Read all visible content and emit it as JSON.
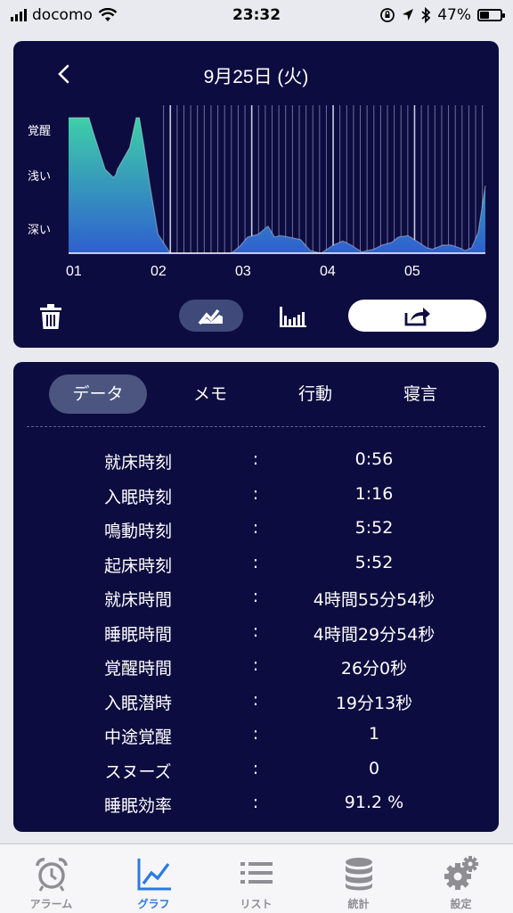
{
  "status_bar": {
    "carrier": "docomo",
    "time": "23:32",
    "battery_percent": "47%",
    "battery_level": 0.47,
    "icons": [
      "signal-icon",
      "wifi-icon",
      "orientation-lock-icon",
      "location-icon",
      "bluetooth-icon",
      "battery-icon"
    ]
  },
  "header": {
    "date": "9月25日 (火)"
  },
  "chart_data": {
    "type": "area",
    "y_categories": [
      "覚醒",
      "浅い",
      "深い"
    ],
    "x_tick_labels": [
      "01",
      "02",
      "03",
      "04",
      "05"
    ],
    "x": [
      0.75,
      0.92,
      0.93,
      1.0,
      1.05,
      1.2,
      1.3,
      1.33,
      1.35,
      1.5,
      1.58,
      1.62,
      1.68,
      1.75,
      1.85,
      2.0,
      2.5,
      2.75,
      2.85,
      2.95,
      3.08,
      3.2,
      3.28,
      3.35,
      3.45,
      3.6,
      3.72,
      3.85,
      4.0,
      4.12,
      4.22,
      4.35,
      4.5,
      4.6,
      4.72,
      4.8,
      4.92,
      5.05,
      5.15,
      5.22,
      5.35,
      5.45,
      5.55,
      5.62,
      5.7,
      5.78,
      5.87
    ],
    "y": [
      0.0,
      0.0,
      0.0,
      0.0,
      0.1,
      0.38,
      0.44,
      0.42,
      0.38,
      0.22,
      0.0,
      0.0,
      0.22,
      0.5,
      0.86,
      1.0,
      1.0,
      1.0,
      0.95,
      0.88,
      0.86,
      0.8,
      0.88,
      0.87,
      0.88,
      0.9,
      0.98,
      1.0,
      0.94,
      0.91,
      0.94,
      0.99,
      0.97,
      0.94,
      0.92,
      0.88,
      0.87,
      0.92,
      0.96,
      0.97,
      0.94,
      0.94,
      0.96,
      0.98,
      0.96,
      0.85,
      0.5
    ],
    "x_range": [
      0.75,
      5.87
    ],
    "y_levels": {
      "覚醒": 0,
      "浅い": 0.42,
      "深い": 0.86
    },
    "colors": {
      "top": "#3ecfa8",
      "bottom": "#2e5fcf",
      "background": "#0d0c40"
    }
  },
  "toolbar": {
    "trash_icon": "trash-icon",
    "line_mode_icon": "line-chart-icon",
    "bar_mode_icon": "bar-chart-icon",
    "share_icon": "share-icon"
  },
  "tabs": [
    {
      "label": "データ",
      "active": true
    },
    {
      "label": "メモ",
      "active": false
    },
    {
      "label": "行動",
      "active": false
    },
    {
      "label": "寝言",
      "active": false
    }
  ],
  "stats": [
    {
      "label": "就床時刻",
      "value": "0:56"
    },
    {
      "label": "入眠時刻",
      "value": "1:16"
    },
    {
      "label": "鳴動時刻",
      "value": "5:52"
    },
    {
      "label": "起床時刻",
      "value": "5:52"
    },
    {
      "label": "就床時間",
      "value": "4時間55分54秒"
    },
    {
      "label": "睡眠時間",
      "value": "4時間29分54秒"
    },
    {
      "label": "覚醒時間",
      "value": "26分0秒"
    },
    {
      "label": "入眠潜時",
      "value": "19分13秒"
    },
    {
      "label": "中途覚醒",
      "value": "1"
    },
    {
      "label": "スヌーズ",
      "value": "0"
    },
    {
      "label": "睡眠効率",
      "value": "91.2 %"
    }
  ],
  "colon": ":",
  "tab_bar": [
    {
      "label": "アラーム",
      "icon": "alarm-clock-icon",
      "active": false
    },
    {
      "label": "グラフ",
      "icon": "graph-icon",
      "active": true
    },
    {
      "label": "リスト",
      "icon": "list-icon",
      "active": false
    },
    {
      "label": "統計",
      "icon": "database-icon",
      "active": false
    },
    {
      "label": "設定",
      "icon": "gear-icon",
      "active": false
    }
  ]
}
